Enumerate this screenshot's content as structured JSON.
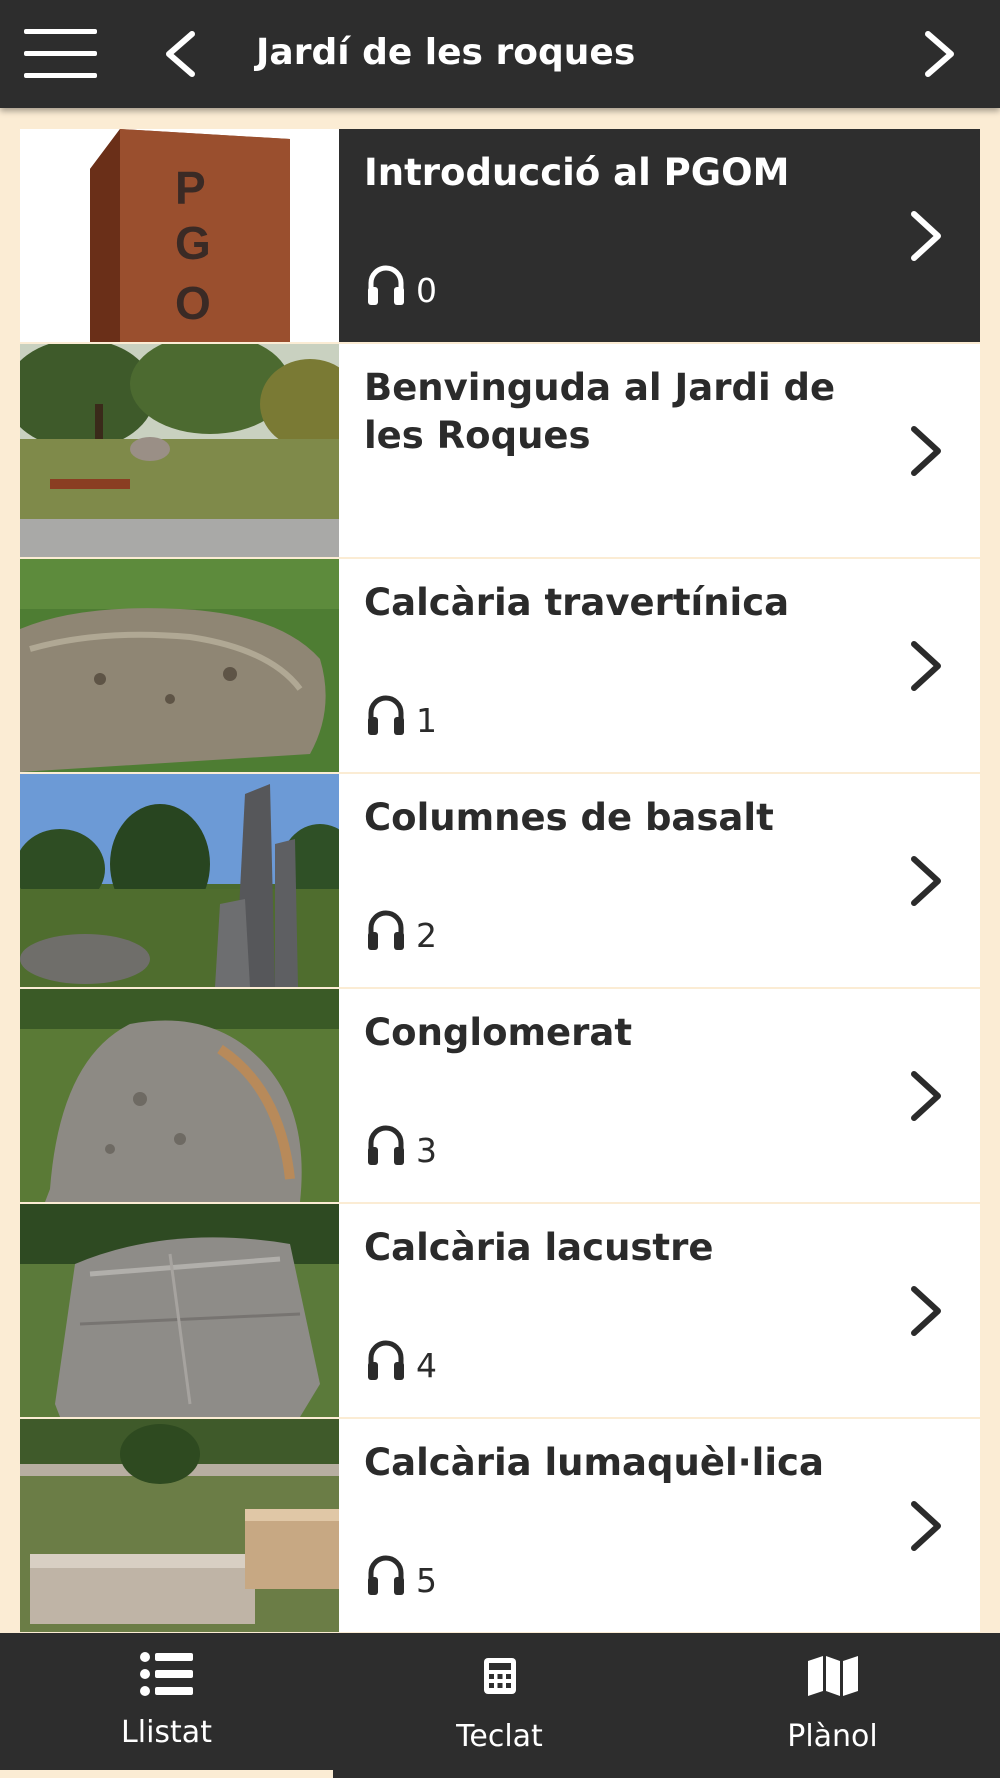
{
  "header": {
    "title": "Jardí de les roques",
    "menu_icon": "hamburger-menu-icon",
    "back_icon": "chevron-left-icon",
    "forward_icon": "chevron-right-icon"
  },
  "items": [
    {
      "title": "Introducció al PGOM",
      "audio": "0",
      "active": true,
      "thumb": "pgom-sculpture"
    },
    {
      "title": "Benvinguda al Jardi de les Roques",
      "audio": "",
      "active": false,
      "thumb": "garden-overview"
    },
    {
      "title": "Calcària travertínica",
      "audio": "1",
      "active": false,
      "thumb": "travertine-rock"
    },
    {
      "title": "Columnes de basalt",
      "audio": "2",
      "active": false,
      "thumb": "basalt-columns"
    },
    {
      "title": "Conglomerat",
      "audio": "3",
      "active": false,
      "thumb": "conglomerate-rock"
    },
    {
      "title": "Calcària lacustre",
      "audio": "4",
      "active": false,
      "thumb": "lacustrine-rock"
    },
    {
      "title": "Calcària lumaquèl·lica",
      "audio": "5",
      "active": false,
      "thumb": "lumachelle-rock"
    }
  ],
  "tabs": [
    {
      "label": "Llistat",
      "icon": "list-icon",
      "selected": true
    },
    {
      "label": "Teclat",
      "icon": "calculator-icon",
      "selected": false
    },
    {
      "label": "Plànol",
      "icon": "map-icon",
      "selected": false
    }
  ],
  "colors": {
    "bar": "#2d2d2d",
    "background": "#fbecd4",
    "active_item": "#2e2e2e",
    "text": "#2b2b2b"
  }
}
